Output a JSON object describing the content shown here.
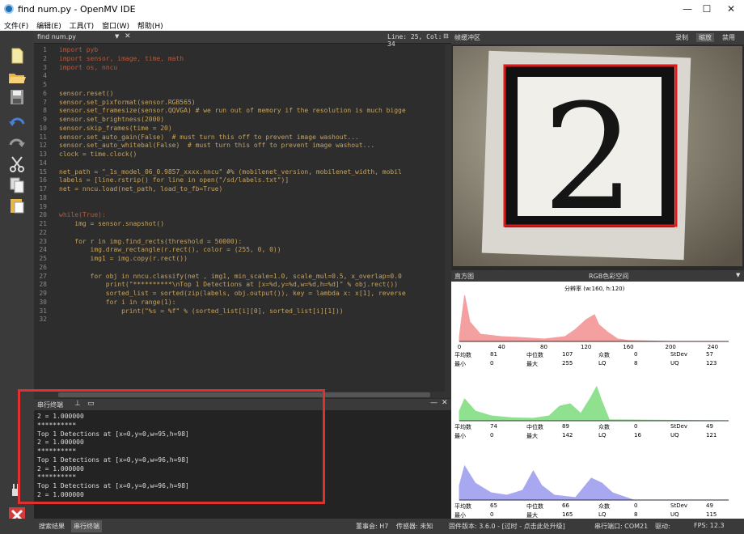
{
  "window": {
    "title": "find num.py - OpenMV IDE",
    "controls": [
      "—",
      "☐",
      "✕"
    ]
  },
  "menu": [
    "文件(F)",
    "编辑(E)",
    "工具(T)",
    "窗口(W)",
    "帮助(H)"
  ],
  "editor": {
    "tab": "find num.py",
    "position": "Line: 25, Col: 34",
    "line_numbers": [
      "1",
      "2",
      "3",
      "4",
      "5",
      "6",
      "7",
      "8",
      "9",
      "10",
      "11",
      "12",
      "13",
      "14",
      "15",
      "16",
      "17",
      "18",
      "19",
      "20",
      "21",
      "22",
      "23",
      "24",
      "25",
      "26",
      "27",
      "28",
      "29",
      "30",
      "31",
      "32"
    ],
    "lines": [
      "import pyb",
      "import sensor, image, time, math",
      "import os, nncu",
      "",
      "",
      "sensor.reset()",
      "sensor.set_pixformat(sensor.RGB565)",
      "sensor.set_framesize(sensor.QQVGA) # we run out of memory if the resolution is much bigge",
      "sensor.set_brightness(2000)",
      "sensor.skip_frames(time = 20)",
      "sensor.set_auto_gain(False)  # must turn this off to prevent image washout...",
      "sensor.set_auto_whitebal(False)  # must turn this off to prevent image washout...",
      "clock = time.clock()",
      "",
      "net_path = \"_1s_model_06_0.9857_xxxx.nncu\" #% (mobilenet_version, mobilenet_width, mobil",
      "labels = [line.rstrip() for line in open(\"/sd/labels.txt\")]",
      "net = nncu.load(net_path, load_to_fb=True)",
      "",
      "",
      "while(True):",
      "    img = sensor.snapshot()",
      "",
      "    for r in img.find_rects(threshold = 50000):",
      "        img.draw_rectangle(r.rect(), color = (255, 0, 0))",
      "        img1 = img.copy(r.rect())",
      "",
      "        for obj in nncu.classify(net , img1, min_scale=1.0, scale_mul=0.5, x_overlap=0.0",
      "            print(\"**********\\nTop 1 Detections at [x=%d,y=%d,w=%d,h=%d]\" % obj.rect())",
      "            sorted_list = sorted(zip(labels, obj.output()), key = lambda x: x[1], reverse",
      "            for i in range(1):",
      "                print(\"%s = %f\" % (sorted_list[i][0], sorted_list[i][1]))",
      ""
    ]
  },
  "serial": {
    "title": "串行终端",
    "lines": [
      "2 = 1.000000",
      "**********",
      "Top 1 Detections at [x=0,y=0,w=95,h=98]",
      "2 = 1.000000",
      "**********",
      "Top 1 Detections at [x=0,y=0,w=96,h=98]",
      "2 = 1.000000",
      "**********",
      "Top 1 Detections at [x=0,y=0,w=96,h=98]",
      "2 = 1.000000"
    ]
  },
  "framebuffer": {
    "title": "帧缓冲区",
    "buttons": [
      "录制",
      "缩放",
      "禁用"
    ],
    "digit": "2"
  },
  "histogram": {
    "title": "直方图",
    "colorspace": "RGB色彩空间",
    "resolution": "分辨率 (w:160, h:120)",
    "x_ticks": [
      "0",
      "40",
      "80",
      "120",
      "160",
      "200",
      "240"
    ],
    "stat_labels": [
      "平均数",
      "中位数",
      "众数",
      "StDev",
      "最小",
      "最大",
      "LQ",
      "UQ"
    ],
    "channels": [
      {
        "color": "#f4a0a0",
        "stats": [
          "81",
          "107",
          "0",
          "57",
          "0",
          "255",
          "8",
          "123"
        ]
      },
      {
        "color": "#8fe08f",
        "stats": [
          "74",
          "89",
          "0",
          "49",
          "0",
          "142",
          "16",
          "121"
        ]
      },
      {
        "color": "#a8a8f0",
        "stats": [
          "65",
          "66",
          "0",
          "49",
          "0",
          "165",
          "8",
          "115"
        ]
      }
    ]
  },
  "bottom": {
    "tabs": [
      "搜索结果",
      "串行终端"
    ],
    "board": "董事会: H7",
    "sensor": "传感器: 未知",
    "firmware": "固件版本: 3.6.0 - [过时 - 点击此处升级]",
    "port": "串行端口: COM21",
    "drive": "驱动:",
    "fps": "FPS: 12.3"
  }
}
